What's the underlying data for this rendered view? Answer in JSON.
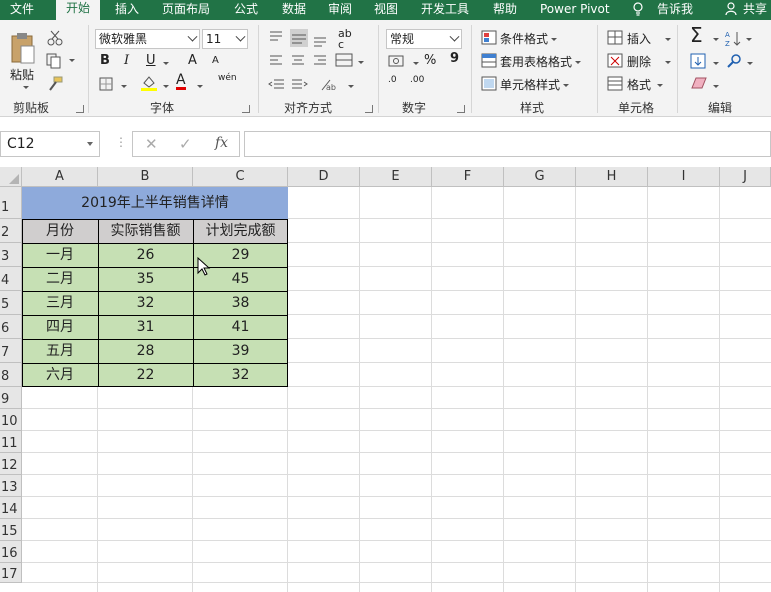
{
  "ribbon_tabs": [
    "文件",
    "开始",
    "插入",
    "页面布局",
    "公式",
    "数据",
    "审阅",
    "视图",
    "开发工具",
    "帮助",
    "Power Pivot",
    "告诉我",
    "共享"
  ],
  "clipboard": {
    "paste": "粘贴",
    "label": "剪贴板"
  },
  "font": {
    "name": "微软雅黑",
    "size": "11",
    "bold": "B",
    "italic": "I",
    "underline": "U",
    "grow": "A",
    "shrink": "A",
    "fill": "A",
    "color": "A",
    "phonetic": "wén",
    "label": "字体"
  },
  "alignment": {
    "label": "对齐方式",
    "wrap": "ab",
    "wrap2": "c"
  },
  "number": {
    "format": "常规",
    "percent": "%",
    "comma": "9",
    "inc_decimal": ".00",
    "dec_decimal": ".0",
    "label": "数字"
  },
  "styles": {
    "conditional": "条件格式",
    "table": "套用表格格式",
    "cell": "单元格样式",
    "label": "样式"
  },
  "cells": {
    "insert": "插入",
    "delete": "删除",
    "format": "格式",
    "label": "单元格"
  },
  "editing": {
    "label": "编辑"
  },
  "formula_bar": {
    "name_box": "C12",
    "cancel": "✕",
    "enter": "✓",
    "fx": "fx",
    "content": ""
  },
  "columns": [
    "A",
    "B",
    "C",
    "D",
    "E",
    "F",
    "G",
    "H",
    "I",
    "J"
  ],
  "rows": [
    "1",
    "2",
    "3",
    "4",
    "5",
    "6",
    "7",
    "8",
    "9",
    "10",
    "11",
    "12",
    "13",
    "14",
    "15",
    "16",
    "17"
  ],
  "sheet": {
    "title": "2019年上半年销售详情",
    "headers": [
      "月份",
      "实际销售额",
      "计划完成额"
    ],
    "data": [
      [
        "一月",
        "26",
        "29"
      ],
      [
        "二月",
        "35",
        "45"
      ],
      [
        "三月",
        "32",
        "38"
      ],
      [
        "四月",
        "31",
        "41"
      ],
      [
        "五月",
        "28",
        "39"
      ],
      [
        "六月",
        "22",
        "32"
      ]
    ]
  },
  "colors": {
    "accent": "#217346",
    "title_fill": "#8eaadb",
    "header_fill": "#d0cece",
    "data_fill": "#c6e0b4"
  }
}
